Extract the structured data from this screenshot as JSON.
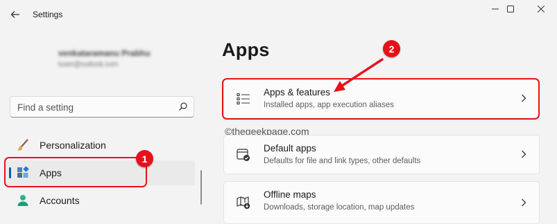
{
  "window": {
    "title": "Settings"
  },
  "user": {
    "name": "venkataramanu Prabhu",
    "email": "tuser@outlook.com"
  },
  "search": {
    "placeholder": "Find a setting"
  },
  "nav": {
    "items": [
      {
        "label": "Personalization",
        "icon": "paintbrush-icon"
      },
      {
        "label": "Apps",
        "icon": "apps-icon",
        "selected": true
      },
      {
        "label": "Accounts",
        "icon": "person-icon"
      }
    ]
  },
  "page": {
    "heading": "Apps"
  },
  "cards": [
    {
      "title": "Apps & features",
      "subtitle": "Installed apps, app execution aliases",
      "icon": "list-icon"
    },
    {
      "title": "Default apps",
      "subtitle": "Defaults for file and link types, other defaults",
      "icon": "default-apps-icon"
    },
    {
      "title": "Offline maps",
      "subtitle": "Downloads, storage location, map updates",
      "icon": "map-icon"
    }
  ],
  "annotations": {
    "badge1": "1",
    "badge2": "2",
    "watermark": "©thegeekpage.com"
  },
  "colors": {
    "accent": "#005fb8",
    "highlight": "#e5121b"
  }
}
